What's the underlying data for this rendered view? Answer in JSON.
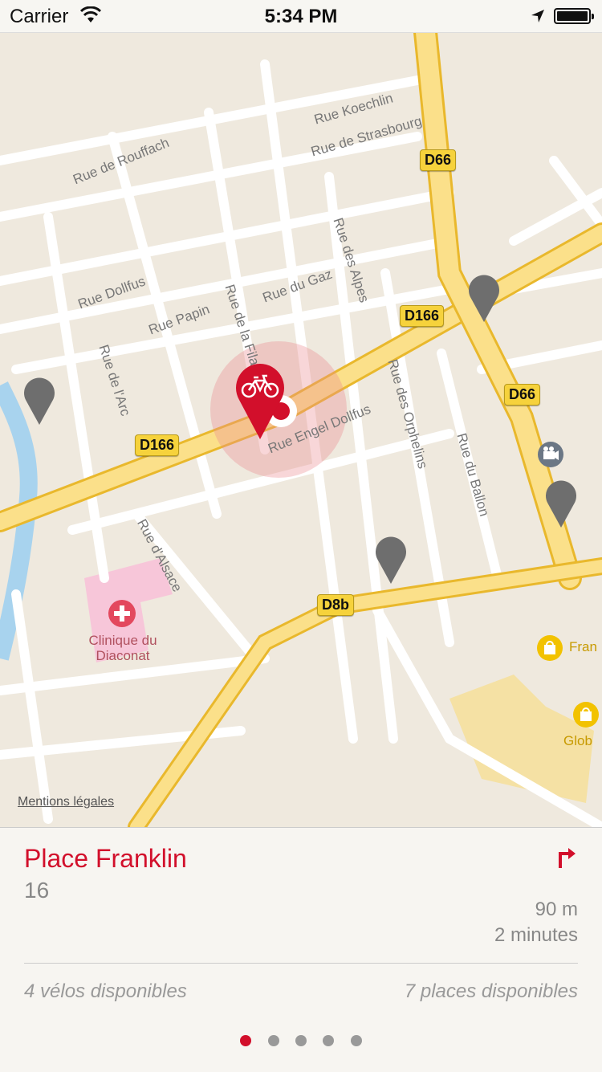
{
  "status": {
    "carrier": "Carrier",
    "time": "5:34 PM"
  },
  "map": {
    "streets": [
      "Rue Koechlin",
      "Rue de Strasbourg",
      "Rue de Rouffach",
      "Rue Dollfus",
      "Rue Papin",
      "Rue du Gaz",
      "Rue des Alpes",
      "Rue de la Fila",
      "Rue de l'Arc",
      "Rue Engel Dollfus",
      "Rue des Orphelins",
      "Rue du Ballon",
      "Rue d'Alsace"
    ],
    "badges": [
      "D66",
      "D166",
      "D66",
      "D166",
      "D8b"
    ],
    "poi": {
      "name_line1": "Clinique du",
      "name_line2": "Diaconat"
    },
    "shops": [
      "Fran",
      "Glob"
    ],
    "mentions": "Mentions légales",
    "colors": {
      "accent": "#d20f2b",
      "major_road": "#fbe08a",
      "road_edge": "#e9b82c"
    }
  },
  "panel": {
    "station_name": "Place Franklin",
    "station_number": "16",
    "distance": "90 m",
    "duration": "2 minutes",
    "bikes": "4 vélos disponibles",
    "places": "7 places disponibles",
    "pages": 5,
    "active_page": 1
  },
  "icons": [
    "wifi-icon",
    "location-arrow-icon",
    "battery-icon",
    "bike-pin-icon",
    "station-pin-icon",
    "directions-icon",
    "hospital-icon",
    "cinema-icon",
    "shopping-bag-icon"
  ]
}
